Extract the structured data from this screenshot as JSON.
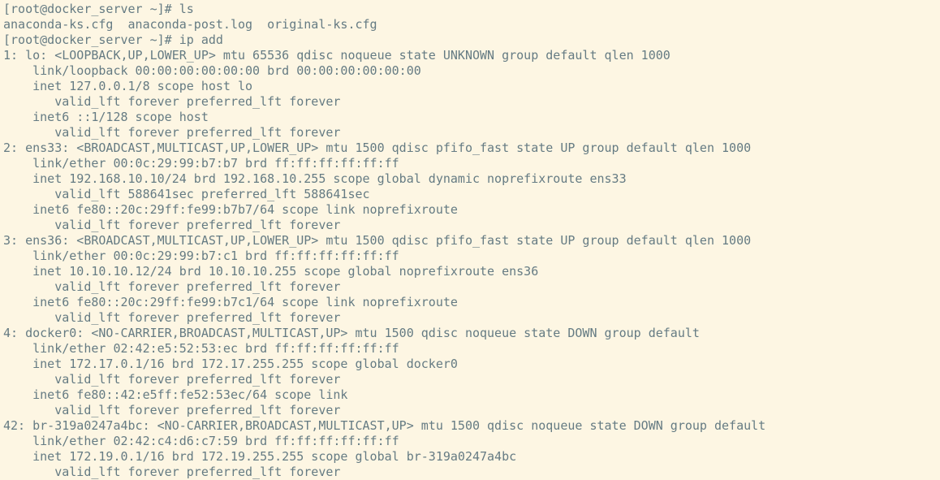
{
  "lines": [
    {
      "type": "prompt",
      "prompt": "[root@docker_server ~]# ",
      "cmd": "ls"
    },
    {
      "type": "out",
      "text": "anaconda-ks.cfg  anaconda-post.log  original-ks.cfg"
    },
    {
      "type": "prompt",
      "prompt": "[root@docker_server ~]# ",
      "cmd": "ip add"
    },
    {
      "type": "out",
      "text": "1: lo: <LOOPBACK,UP,LOWER_UP> mtu 65536 qdisc noqueue state UNKNOWN group default qlen 1000"
    },
    {
      "type": "out",
      "text": "    link/loopback 00:00:00:00:00:00 brd 00:00:00:00:00:00"
    },
    {
      "type": "out",
      "text": "    inet 127.0.0.1/8 scope host lo"
    },
    {
      "type": "out",
      "text": "       valid_lft forever preferred_lft forever"
    },
    {
      "type": "out",
      "text": "    inet6 ::1/128 scope host"
    },
    {
      "type": "out",
      "text": "       valid_lft forever preferred_lft forever"
    },
    {
      "type": "out",
      "text": "2: ens33: <BROADCAST,MULTICAST,UP,LOWER_UP> mtu 1500 qdisc pfifo_fast state UP group default qlen 1000"
    },
    {
      "type": "out",
      "text": "    link/ether 00:0c:29:99:b7:b7 brd ff:ff:ff:ff:ff:ff"
    },
    {
      "type": "out",
      "text": "    inet 192.168.10.10/24 brd 192.168.10.255 scope global dynamic noprefixroute ens33"
    },
    {
      "type": "out",
      "text": "       valid_lft 588641sec preferred_lft 588641sec"
    },
    {
      "type": "out",
      "text": "    inet6 fe80::20c:29ff:fe99:b7b7/64 scope link noprefixroute"
    },
    {
      "type": "out",
      "text": "       valid_lft forever preferred_lft forever"
    },
    {
      "type": "out",
      "text": "3: ens36: <BROADCAST,MULTICAST,UP,LOWER_UP> mtu 1500 qdisc pfifo_fast state UP group default qlen 1000"
    },
    {
      "type": "out",
      "text": "    link/ether 00:0c:29:99:b7:c1 brd ff:ff:ff:ff:ff:ff"
    },
    {
      "type": "out",
      "text": "    inet 10.10.10.12/24 brd 10.10.10.255 scope global noprefixroute ens36"
    },
    {
      "type": "out",
      "text": "       valid_lft forever preferred_lft forever"
    },
    {
      "type": "out",
      "text": "    inet6 fe80::20c:29ff:fe99:b7c1/64 scope link noprefixroute"
    },
    {
      "type": "out",
      "text": "       valid_lft forever preferred_lft forever"
    },
    {
      "type": "out",
      "text": "4: docker0: <NO-CARRIER,BROADCAST,MULTICAST,UP> mtu 1500 qdisc noqueue state DOWN group default"
    },
    {
      "type": "out",
      "text": "    link/ether 02:42:e5:52:53:ec brd ff:ff:ff:ff:ff:ff"
    },
    {
      "type": "out",
      "text": "    inet 172.17.0.1/16 brd 172.17.255.255 scope global docker0"
    },
    {
      "type": "out",
      "text": "       valid_lft forever preferred_lft forever"
    },
    {
      "type": "out",
      "text": "    inet6 fe80::42:e5ff:fe52:53ec/64 scope link"
    },
    {
      "type": "out",
      "text": "       valid_lft forever preferred_lft forever"
    },
    {
      "type": "out",
      "text": "42: br-319a0247a4bc: <NO-CARRIER,BROADCAST,MULTICAST,UP> mtu 1500 qdisc noqueue state DOWN group default"
    },
    {
      "type": "out",
      "text": "    link/ether 02:42:c4:d6:c7:59 brd ff:ff:ff:ff:ff:ff"
    },
    {
      "type": "out",
      "text": "    inet 172.19.0.1/16 brd 172.19.255.255 scope global br-319a0247a4bc"
    },
    {
      "type": "out",
      "text": "       valid_lft forever preferred_lft forever"
    }
  ]
}
